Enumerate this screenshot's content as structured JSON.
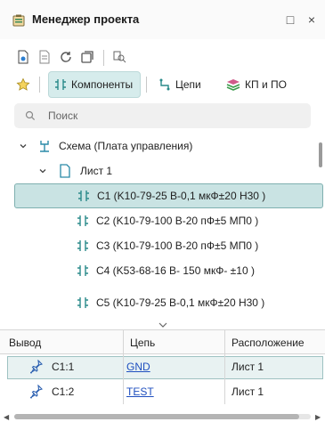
{
  "window": {
    "title": "Менеджер проекта",
    "maximize_glyph": "□",
    "close_glyph": "×"
  },
  "tabs": [
    {
      "label": "",
      "icon": "star-icon"
    },
    {
      "label": "Компоненты",
      "icon": "component-icon",
      "active": true
    },
    {
      "label": "Цепи",
      "icon": "net-icon"
    },
    {
      "label": "КП и ПО",
      "icon": "pads-icon"
    }
  ],
  "search": {
    "placeholder": "Поиск"
  },
  "tree": {
    "root": "Схема (Плата управления)",
    "sheet": "Лист 1",
    "components": [
      "C1 (K10-79-25 B-0,1 мкФ±20 H30 )",
      "C2 (K10-79-100 B-20 пФ±5 МП0 )",
      "C3 (K10-79-100 B-20 пФ±5 МП0 )",
      "C4 (K53-68-16 B- 150 мкФ- ±10 )",
      "C5 (K10-79-25 B-0,1 мкФ±20 H30 )"
    ]
  },
  "table": {
    "headers": [
      "Вывод",
      "Цепь",
      "Расположение"
    ],
    "rows": [
      {
        "pin": "C1:1",
        "net": "GND",
        "location": "Лист 1",
        "selected": true
      },
      {
        "pin": "C1:2",
        "net": "TEST",
        "location": "Лист 1",
        "selected": false
      }
    ]
  },
  "colors": {
    "accent": "#c9e3e3",
    "accent_border": "#7fb0b0",
    "link": "#1f4fbf"
  }
}
